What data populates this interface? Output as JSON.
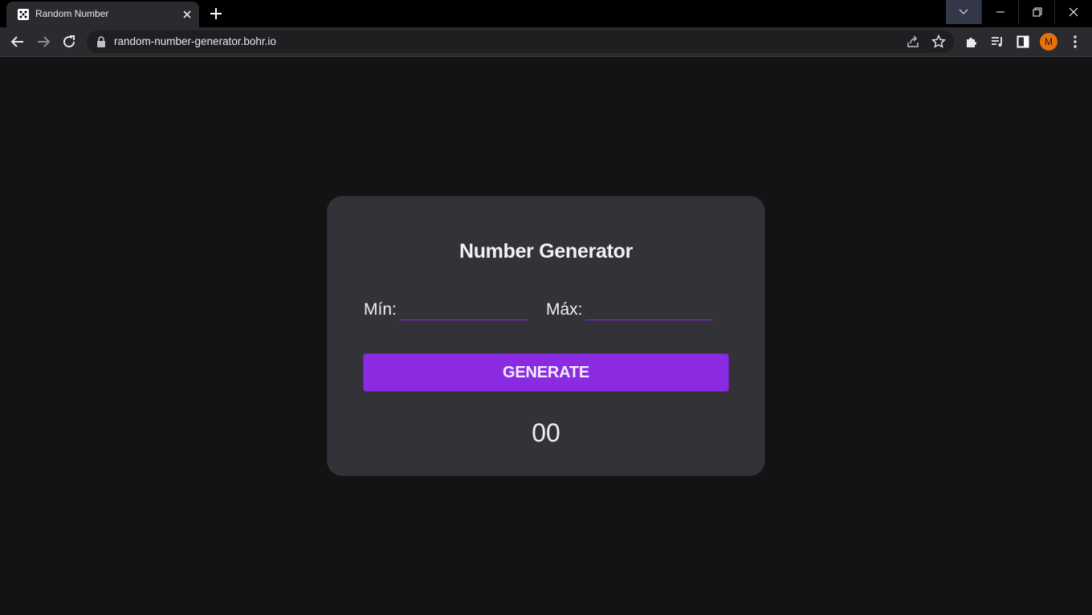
{
  "browser": {
    "tab": {
      "title": "Random Number",
      "favicon": "dice-icon"
    },
    "url": "random-number-generator.bohr.io",
    "profile_initial": "M",
    "colors": {
      "tabstrip": "#000000",
      "toolbar": "#2b2b2f",
      "avatar": "#e8710a"
    }
  },
  "app": {
    "title": "Number Generator",
    "min_label": "Mín:",
    "max_label": "Máx:",
    "min_value": "",
    "max_value": "",
    "generate_label": "GENERATE",
    "result": "00",
    "colors": {
      "background": "#131313",
      "card": "#323238",
      "accent": "#8a2be2",
      "text": "#f0f0f0"
    }
  }
}
